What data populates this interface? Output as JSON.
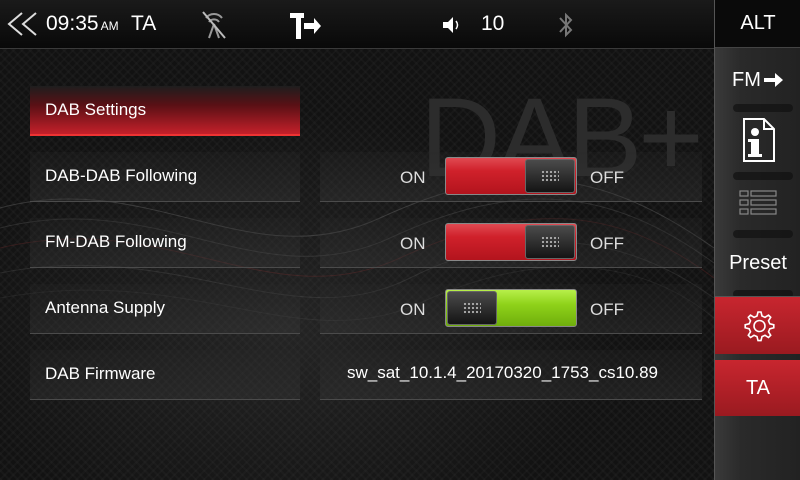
{
  "status_bar": {
    "time": "09:35",
    "ampm": "AM",
    "ta": "TA",
    "volume": "10",
    "icons": [
      "back-icon",
      "signal-off-icon",
      "navigation-turn-icon",
      "volume-icon",
      "bluetooth-icon"
    ]
  },
  "watermark": "DAB+",
  "sidebar": {
    "alt": "ALT",
    "fm": "FM",
    "preset": "Preset",
    "ta": "TA",
    "icons": [
      "arrow-right-icon",
      "info-icon",
      "list-icon",
      "gear-icon"
    ]
  },
  "settings": {
    "header": "DAB Settings",
    "rows": [
      {
        "label": "DAB-DAB Following",
        "on": "ON",
        "off": "OFF",
        "state": "OFF"
      },
      {
        "label": "FM-DAB Following",
        "on": "ON",
        "off": "OFF",
        "state": "OFF"
      },
      {
        "label": "Antenna Supply",
        "on": "ON",
        "off": "OFF",
        "state": "ON"
      }
    ],
    "firmware_label": "DAB Firmware",
    "firmware_value": "sw_sat_10.1.4_20170320_1753_cs10.89"
  },
  "colors": {
    "accent_red": "#c8262f",
    "toggle_on_green": "#8fd21a",
    "background": "#121212"
  }
}
